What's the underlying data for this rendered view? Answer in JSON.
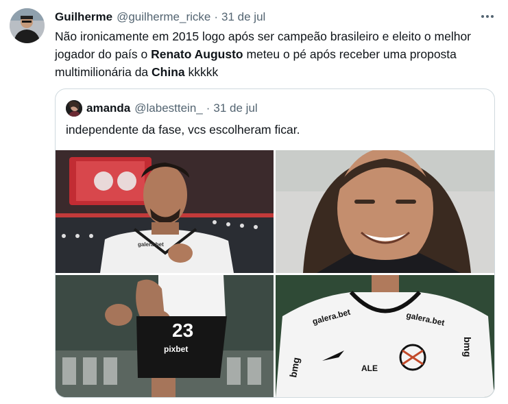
{
  "tweet": {
    "author_name": "Guilherme",
    "author_handle": "@guilherme_ricke",
    "separator": "·",
    "date": "31 de jul",
    "text_parts": [
      "Não ironicamente em 2015 logo após ser campeão brasileiro e eleito o melhor jogador do país o ",
      "Renato Augusto",
      " meteu o pé após receber uma proposta multimilionária da ",
      "China",
      " kkkkk"
    ],
    "more_icon": "more-horizontal-icon"
  },
  "quote": {
    "author_name": "amanda",
    "author_handle": "@labesttein_",
    "separator": "·",
    "date": "31 de jul",
    "text": "independente da fase, vcs escolheram ficar.",
    "images": [
      {
        "name": "photo-player-celebrating-stadium"
      },
      {
        "name": "photo-player-long-hair-smiling"
      },
      {
        "name": "photo-player-number-23-fist-pump"
      },
      {
        "name": "photo-corinthians-jersey-closeup"
      }
    ]
  },
  "photo_text": {
    "sponsor_galera": "galera.bet",
    "sponsor_bmg": "bmg",
    "sponsor_ale": "ALE",
    "number": "23",
    "shorts_sponsor": "pixbet"
  },
  "colors": {
    "text_primary": "#0f1419",
    "text_secondary": "#536471",
    "border": "#cfd9de",
    "background": "#ffffff"
  }
}
